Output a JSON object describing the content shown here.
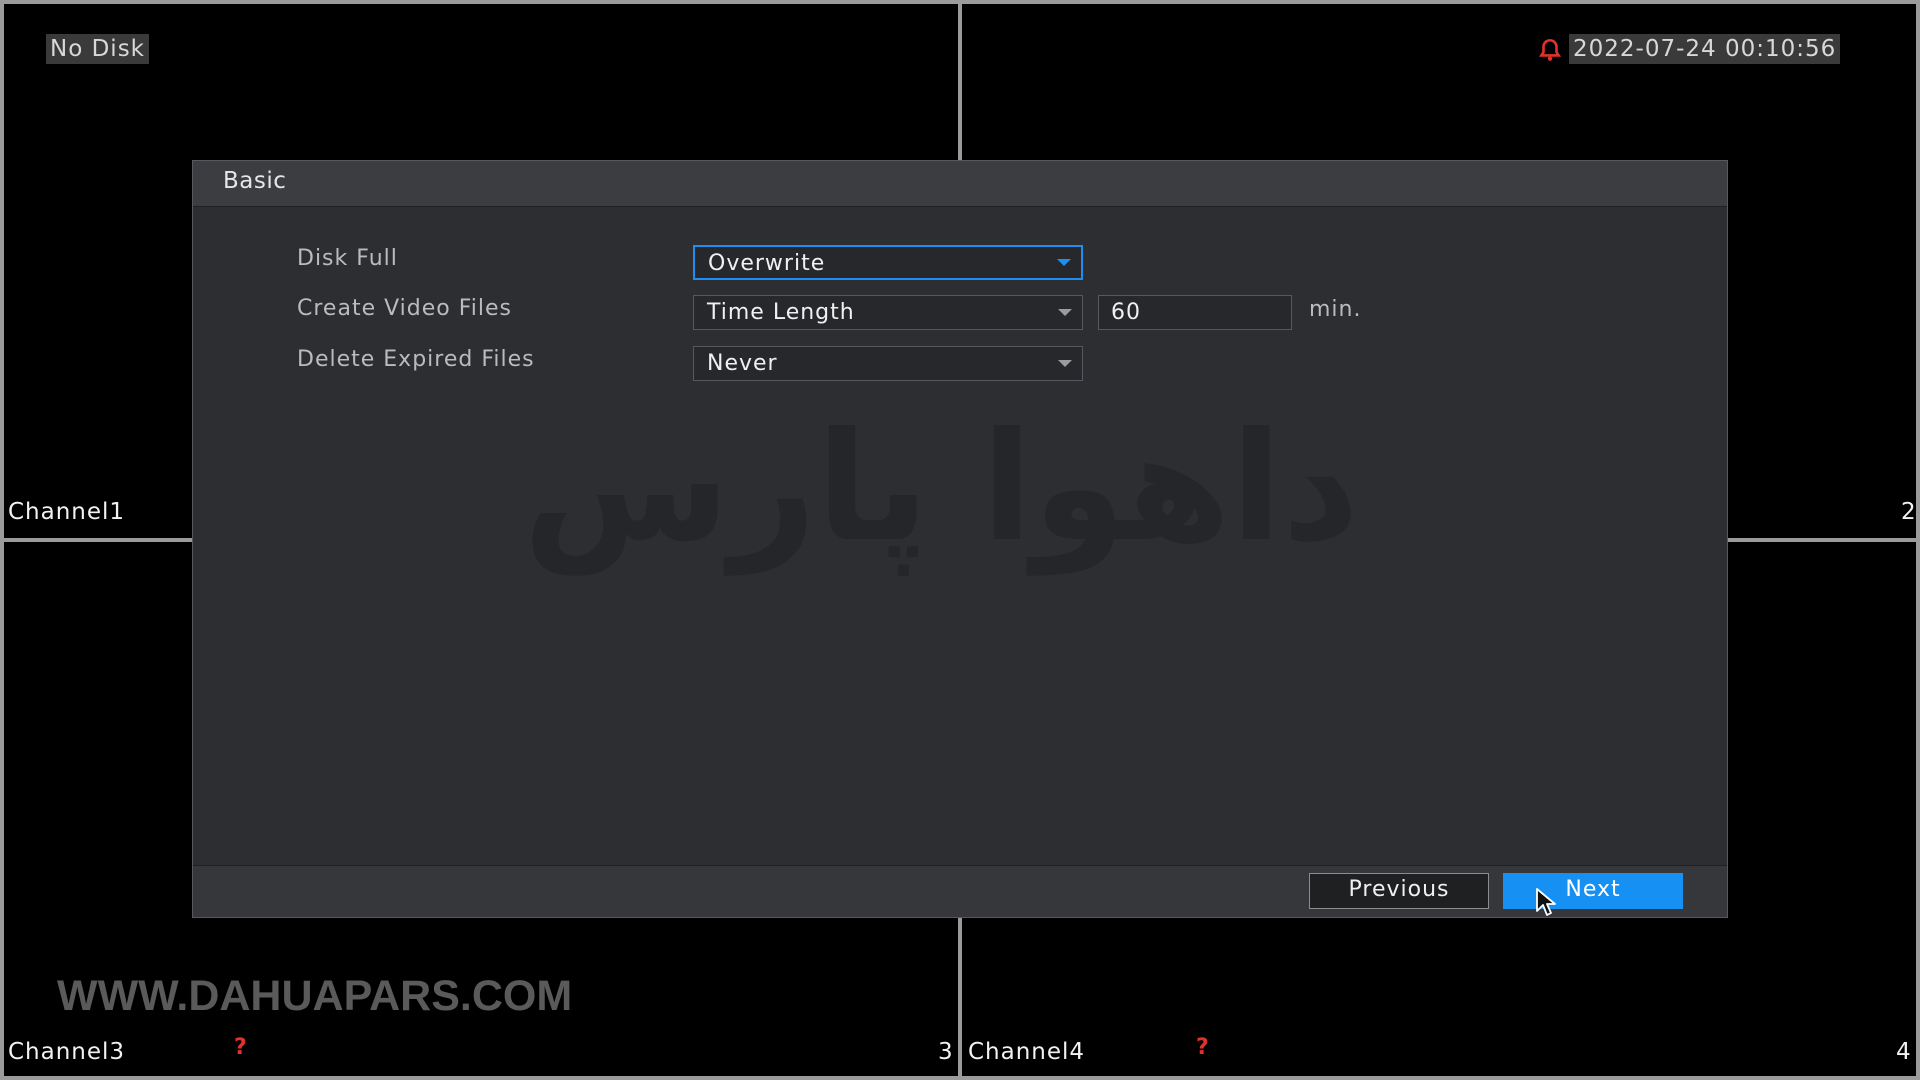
{
  "osd": {
    "disk_status": "No Disk",
    "datetime": "2022-07-24 00:10:56"
  },
  "channels": [
    {
      "name": "Channel1",
      "number": ""
    },
    {
      "name": "",
      "number": "2"
    },
    {
      "name": "Channel3",
      "number": "3"
    },
    {
      "name": "Channel4",
      "number": "4"
    }
  ],
  "watermark": {
    "url": "WWW.DAHUAPARS.COM",
    "persian": "داهوا پارس"
  },
  "dialog": {
    "title": "Basic",
    "fields": {
      "disk_full": {
        "label": "Disk Full",
        "value": "Overwrite"
      },
      "create_video_files": {
        "label": "Create Video Files",
        "value": "Time Length",
        "length": "60",
        "unit": "min."
      },
      "delete_expired_files": {
        "label": "Delete Expired Files",
        "value": "Never"
      }
    },
    "buttons": {
      "previous": "Previous",
      "next": "Next"
    }
  },
  "icons": {
    "alarm": "bell-icon",
    "unknown_device": "question-mark-icon",
    "cursor": "mouse-pointer-icon"
  },
  "colors": {
    "accent": "#1690f2",
    "alarm": "#e0322a"
  }
}
